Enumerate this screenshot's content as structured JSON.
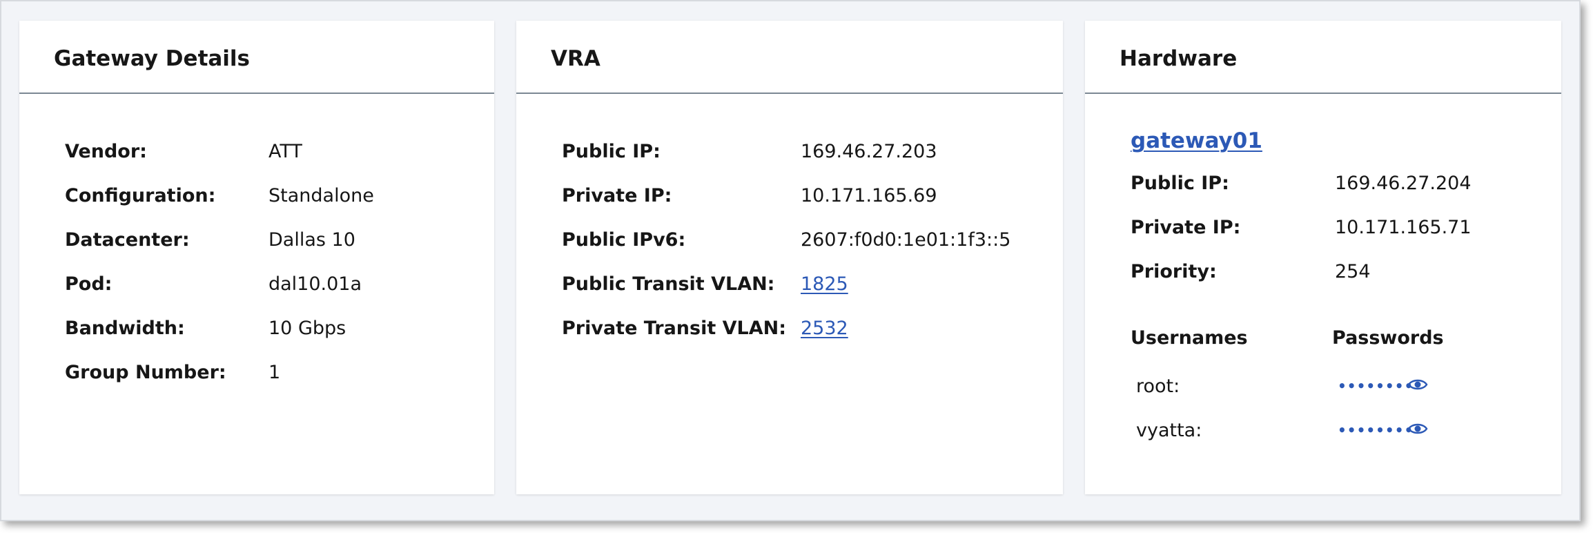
{
  "gateway_details": {
    "title": "Gateway Details",
    "rows": [
      {
        "label": "Vendor:",
        "value": "ATT"
      },
      {
        "label": "Configuration:",
        "value": "Standalone"
      },
      {
        "label": "Datacenter:",
        "value": "Dallas 10"
      },
      {
        "label": "Pod:",
        "value": "dal10.01a"
      },
      {
        "label": "Bandwidth:",
        "value": "10 Gbps"
      },
      {
        "label": "Group Number:",
        "value": "1"
      }
    ]
  },
  "vra": {
    "title": "VRA",
    "rows": [
      {
        "label": "Public IP:",
        "value": "169.46.27.203"
      },
      {
        "label": "Private IP:",
        "value": "10.171.165.69"
      },
      {
        "label": "Public IPv6:",
        "value": "2607:f0d0:1e01:1f3::5"
      },
      {
        "label": "Public Transit VLAN:",
        "value": "1825"
      },
      {
        "label": "Private Transit VLAN:",
        "value": "2532"
      }
    ]
  },
  "hardware": {
    "title": "Hardware",
    "device_link": "gateway01",
    "rows": [
      {
        "label": "Public IP:",
        "value": "169.46.27.204"
      },
      {
        "label": "Private IP:",
        "value": "10.171.165.71"
      },
      {
        "label": "Priority:",
        "value": "254"
      }
    ],
    "credentials": {
      "usernames_header": "Usernames",
      "passwords_header": "Passwords",
      "entries": [
        {
          "username": "root:",
          "password_mask": "••••••••",
          "toggle_icon": "eye-icon"
        },
        {
          "username": "vyatta:",
          "password_mask": "••••••••",
          "toggle_icon": "eye-icon"
        }
      ]
    }
  },
  "colors": {
    "link": "#2c59b6",
    "header_rule": "#7b8793",
    "background": "#f2f4f8"
  }
}
